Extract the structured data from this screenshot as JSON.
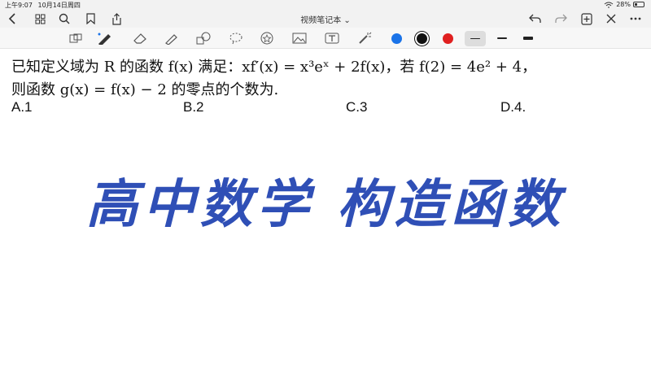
{
  "status": {
    "time": "上午9:07",
    "date": "10月14日周四",
    "battery": "28%"
  },
  "nav": {
    "title": "视频笔记本",
    "title_chevron": "⌄"
  },
  "toolbar": {
    "colors": [
      "#1a73e8",
      "#111111",
      "#e02020"
    ]
  },
  "question": {
    "line1": "已知定义域为 R 的函数 f(x) 满足：xf′(x) = x³eˣ + 2f(x)，若 f(2) = 4e² + 4，",
    "line2": "则函数 g(x) = f(x) − 2 的零点的个数为.",
    "options": [
      "A.1",
      "B.2",
      "C.3",
      "D.4."
    ]
  },
  "banner": "高中数学  构造函数"
}
